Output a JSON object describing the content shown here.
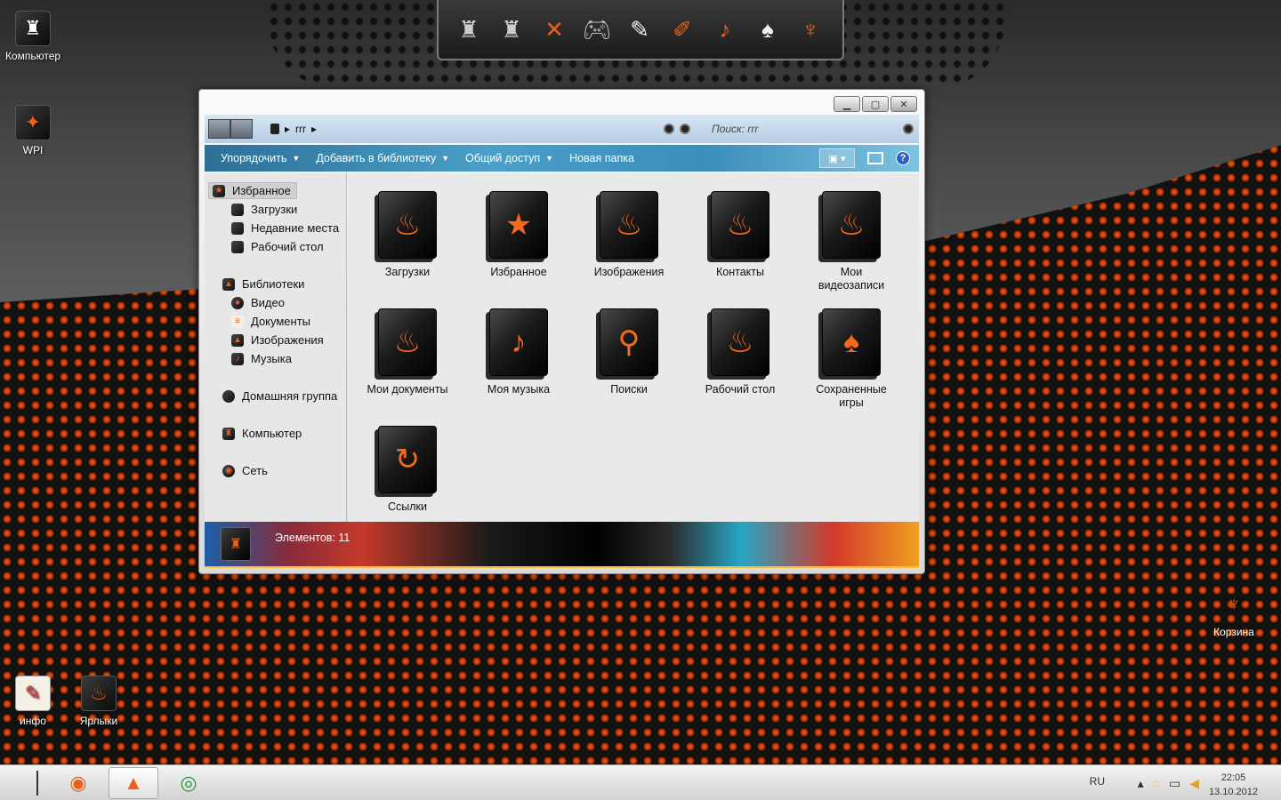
{
  "desktop": {
    "icons": [
      {
        "label": "Компьютер",
        "icon": "computer-icon"
      },
      {
        "label": "WPI",
        "icon": "wpi-icon"
      },
      {
        "label": "инфо",
        "icon": "notepad-icon"
      },
      {
        "label": "Ярлыки",
        "icon": "shortcuts-icon"
      },
      {
        "label": "Корзина",
        "icon": "recycle-bin-icon"
      }
    ]
  },
  "dock": {
    "items": [
      "computer-icon",
      "network-icon",
      "tools-icon",
      "gamepad-icon",
      "notepad-icon",
      "paint-icon",
      "guitar-icon",
      "games-icon",
      "recycle-bin-icon"
    ]
  },
  "window": {
    "address": {
      "crumb": "rrr",
      "search_label": "Поиск: rrr"
    },
    "toolbar": {
      "organize": "Упорядочить",
      "add_library": "Добавить в библиотеку",
      "share": "Общий доступ",
      "new_folder": "Новая папка",
      "help": "?"
    },
    "nav": {
      "favorites": "Избранное",
      "downloads": "Загрузки",
      "recent": "Недавние места",
      "desktop": "Рабочий стол",
      "libraries": "Библиотеки",
      "video": "Видео",
      "documents": "Документы",
      "images": "Изображения",
      "music": "Музыка",
      "homegroup": "Домашняя группа",
      "computer": "Компьютер",
      "network": "Сеть"
    },
    "files": [
      {
        "name": "Загрузки",
        "icon": "flame-arrow-icon"
      },
      {
        "name": "Избранное",
        "icon": "star-icon"
      },
      {
        "name": "Изображения",
        "icon": "camera-icon"
      },
      {
        "name": "Контакты",
        "icon": "contacts-icon"
      },
      {
        "name": "Мои видеозаписи",
        "icon": "video-camera-icon"
      },
      {
        "name": "Мои документы",
        "icon": "documents-icon"
      },
      {
        "name": "Моя музыка",
        "icon": "guitar-icon"
      },
      {
        "name": "Поиски",
        "icon": "magnifier-icon"
      },
      {
        "name": "Рабочий стол",
        "icon": "desktop-icon"
      },
      {
        "name": "Сохраненные игры",
        "icon": "cards-icon"
      },
      {
        "name": "Ссылки",
        "icon": "link-arrow-icon"
      }
    ],
    "status": {
      "count_text": "Элементов: 11"
    }
  },
  "taskbar": {
    "language": "RU",
    "time": "22:05",
    "date": "13.10.2012"
  },
  "colors": {
    "accent": "#e8601a",
    "toolbar_blue": "#3b8dbb",
    "address_blue": "#c7dbee"
  }
}
